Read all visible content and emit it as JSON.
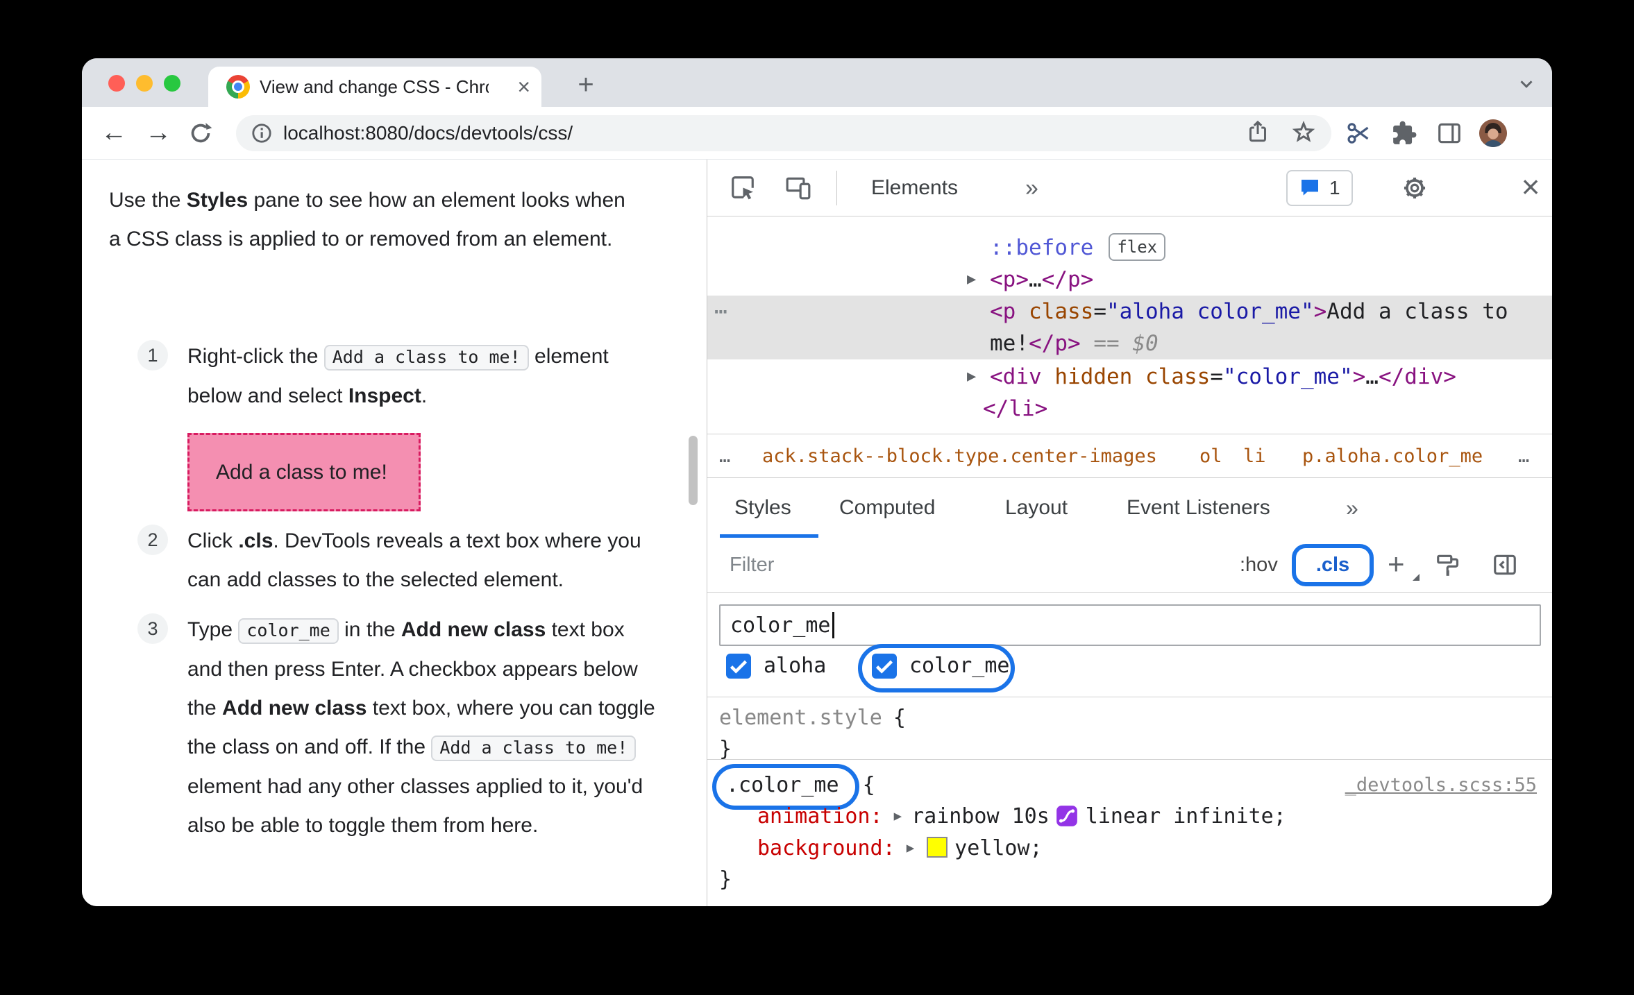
{
  "browser": {
    "tab_title": "View and change CSS - Chrom",
    "close_tab": "×",
    "new_tab": "+",
    "url": "localhost:8080/docs/devtools/css/",
    "icons": {
      "back": "←",
      "forward": "→"
    },
    "traffic_lights": [
      "#ff5f57",
      "#febc2e",
      "#28c840"
    ]
  },
  "docs": {
    "intro": [
      "Use the ",
      "Styles",
      " pane to see how an element looks when a CSS class is applied to or removed from an element."
    ],
    "step1": {
      "num": "1",
      "pre": "Right-click the ",
      "code": "Add a class to me!",
      "mid": " element below and select ",
      "bold": "Inspect",
      "post": "."
    },
    "pink_box": "Add a class to me!",
    "step2": {
      "num": "2",
      "pre": "Click ",
      "bold": ".cls",
      "post": ". DevTools reveals a text box where you can add classes to the selected element."
    },
    "step3": {
      "num": "3",
      "s0": "Type ",
      "code1": "color_me",
      "s1": " in the ",
      "b1": "Add new class",
      "s2": " text box and then press Enter. A checkbox appears below the ",
      "b2": "Add new class",
      "s3": " text box, where you can toggle the class on and off. If the ",
      "code2": "Add a class to me!",
      "s4": " element had any other classes applied to it, you'd also be able to toggle them from here."
    }
  },
  "devtools": {
    "toolbar": {
      "tab": "Elements",
      "more": "»",
      "issues_count": "1"
    },
    "dom": {
      "arrow": "▶",
      "pseudo": "::before",
      "flex_badge": "flex",
      "collapsed_p": {
        "open": "<p>",
        "dots": "…",
        "close": "</p>"
      },
      "selected": {
        "more": "⋯",
        "open": "<p ",
        "attr": "class",
        "eq": "=",
        "value": "\"aloha color_me\"",
        "bracket": ">",
        "text1": "Add a class to",
        "text2": "me!",
        "close": "</p>",
        "flag_eq": " == ",
        "flag": "$0"
      },
      "div_row": {
        "open": "<div ",
        "attr1": "hidden ",
        "attr2": "class",
        "eq": "=",
        "value": "\"color_me\"",
        "bracket": ">",
        "dots": "…",
        "close": "</div>"
      },
      "closing_li": "</li>"
    },
    "breadcrumbs": {
      "left_more": "…",
      "crumb1": "ack.stack--block.type.center-images",
      "crumb2": "ol",
      "crumb3": "li",
      "crumb4": "p.aloha.color_me",
      "right_more": "…"
    },
    "tabs": [
      "Styles",
      "Computed",
      "Layout",
      "Event Listeners"
    ],
    "tabs_more": "»",
    "filter_bar": {
      "placeholder": "Filter",
      "hov": ":hov",
      "cls": ".cls",
      "add": "+"
    },
    "class_editor": {
      "input_value": "color_me",
      "classes": [
        {
          "label": "aloha",
          "checked": true
        },
        {
          "label": "color_me",
          "checked": true
        }
      ]
    },
    "rules": {
      "arrow": "▶",
      "element_style": {
        "selector": "element.style",
        "open": "{",
        "close": "}"
      },
      "color_me": {
        "selector": ".color_me",
        "open": "{",
        "close": "}",
        "source": "_devtools.scss:55",
        "animation_name": "animation:",
        "animation_v1": "rainbow 10s",
        "animation_v2": "linear infinite;",
        "background_name": "background:",
        "background_value": "yellow;",
        "swatch_color": "#ffff00"
      }
    }
  },
  "colors": {
    "accent_blue": "#1a73e8",
    "selection_gray": "#e3e3e3",
    "pink_box_bg": "#f48fb1",
    "pink_box_border": "#d81b60",
    "tag_purple": "#881280",
    "attr_orange": "#994500",
    "value_blue": "#1a1aa6",
    "property_red": "#c80000"
  }
}
